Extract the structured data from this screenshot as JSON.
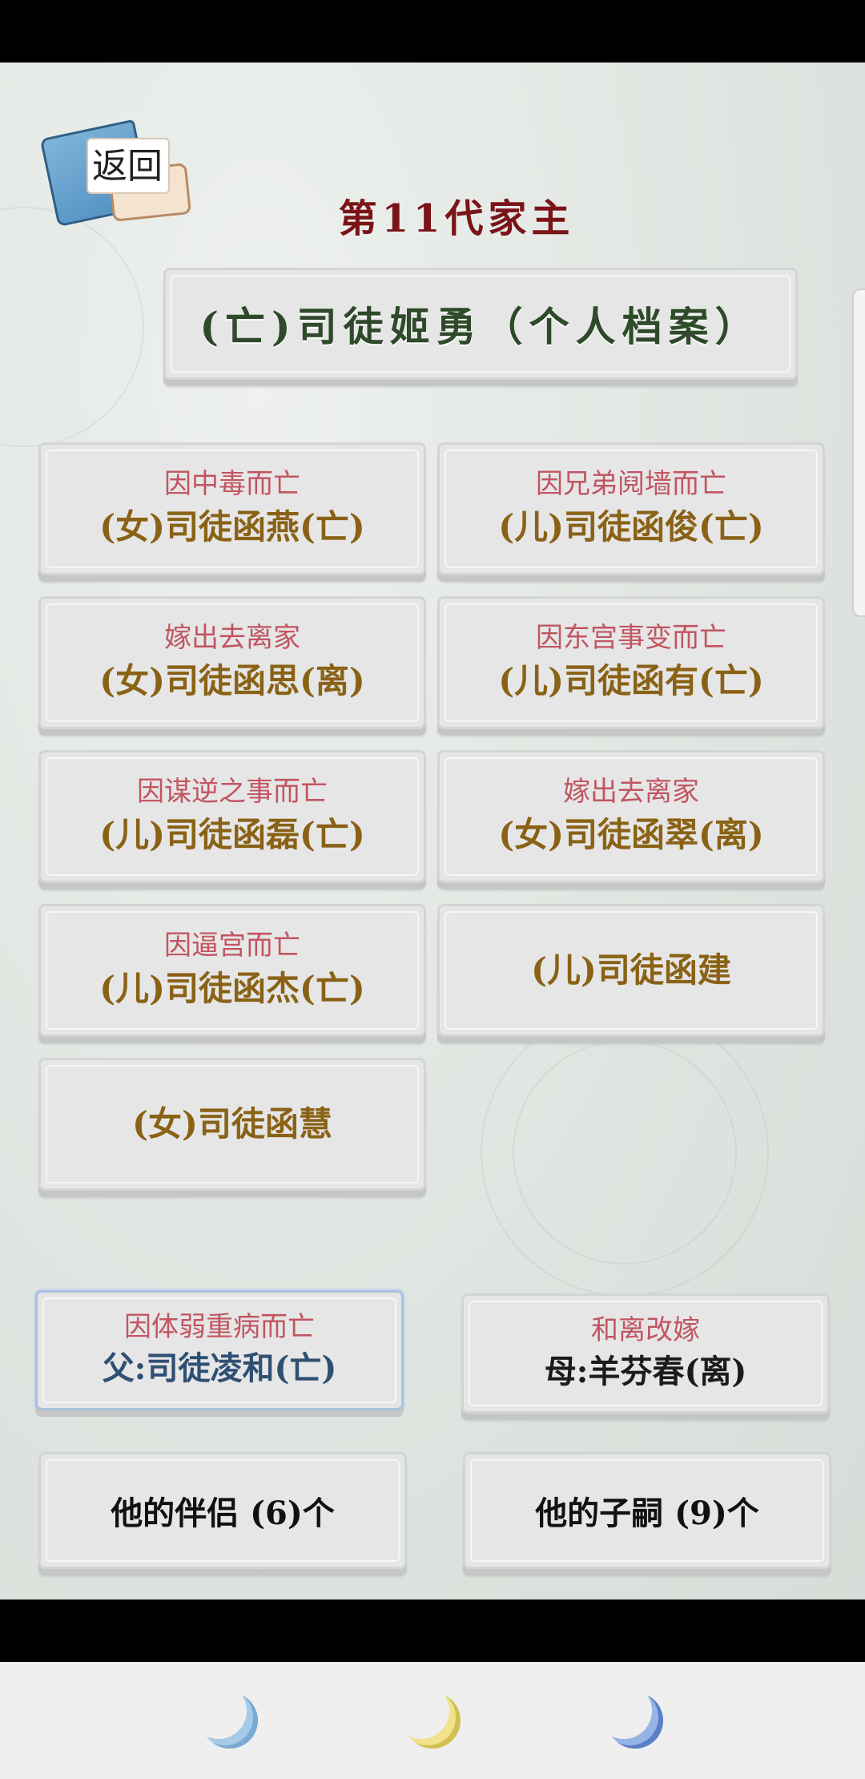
{
  "header": {
    "back_label": "返回",
    "generation_title": "第11代家主"
  },
  "profile": {
    "name": "(亡)司徒姬勇（个人档案）"
  },
  "children": [
    {
      "note": "因中毒而亡",
      "name": "(女)司徒函燕(亡)"
    },
    {
      "note": "因兄弟阋墙而亡",
      "name": "(儿)司徒函俊(亡)"
    },
    {
      "note": "嫁出去离家",
      "name": "(女)司徒函思(离)"
    },
    {
      "note": "因东宫事变而亡",
      "name": "(儿)司徒函有(亡)"
    },
    {
      "note": "因谋逆之事而亡",
      "name": "(儿)司徒函磊(亡)"
    },
    {
      "note": "嫁出去离家",
      "name": "(女)司徒函翠(离)"
    },
    {
      "note": "因逼宫而亡",
      "name": "(儿)司徒函杰(亡)"
    },
    {
      "note": "",
      "name": "(儿)司徒函建"
    },
    {
      "note": "",
      "name": "(女)司徒函慧"
    }
  ],
  "parents": {
    "father": {
      "note": "因体弱重病而亡",
      "name": "父:司徒凌和(亡)"
    },
    "mother": {
      "note": "和离改嫁",
      "name": "母:羊芬春(离)"
    }
  },
  "summary": {
    "partners_label": "他的伴侣 (6)个",
    "children_label": "他的子嗣 (9)个"
  },
  "navbar": {
    "icons": [
      "moon-icon-blue",
      "moon-icon-yellow",
      "moon-icon-indigo"
    ]
  }
}
